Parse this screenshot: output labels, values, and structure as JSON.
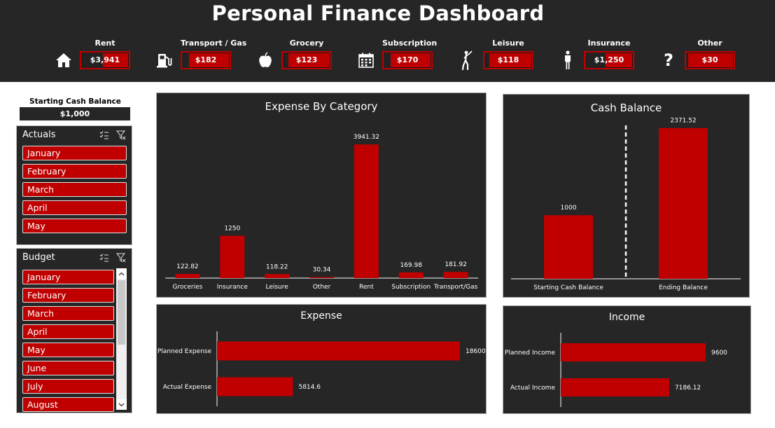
{
  "dashboard": {
    "title": "Personal Finance Dashboard"
  },
  "kpis": [
    {
      "label": "Rent",
      "value": "$3,941",
      "icon": "house-icon",
      "fill": 0.45
    },
    {
      "label": "Transport / Gas",
      "value": "$182",
      "icon": "gas-pump-icon",
      "fill": 0.15
    },
    {
      "label": "Grocery",
      "value": "$123",
      "icon": "apple-icon",
      "fill": 0.12
    },
    {
      "label": "Subscription",
      "value": "$170",
      "icon": "calendar-icon",
      "fill": 0.14
    },
    {
      "label": "Leisure",
      "value": "$118",
      "icon": "golfer-icon",
      "fill": 0.11
    },
    {
      "label": "Insurance",
      "value": "$1,250",
      "icon": "person-icon",
      "fill": 0.42
    },
    {
      "label": "Other",
      "value": "$30",
      "icon": "question-icon",
      "fill": 0.05
    }
  ],
  "cash": {
    "label": "Starting Cash Balance",
    "value": "$1,000"
  },
  "slicers": {
    "actuals": {
      "title": "Actuals",
      "items": [
        "January",
        "February",
        "March",
        "April",
        "May"
      ]
    },
    "budget": {
      "title": "Budget",
      "items": [
        "January",
        "February",
        "March",
        "April",
        "May",
        "June",
        "July",
        "August"
      ]
    }
  },
  "chart_data": [
    {
      "type": "bar",
      "title": "Expense By Category",
      "categories": [
        "Groceries",
        "Insurance",
        "Leisure",
        "Other",
        "Rent",
        "Subscription",
        "Transport/Gas"
      ],
      "values": [
        122.82,
        1250,
        118.22,
        30.34,
        3941.32,
        169.98,
        181.92
      ],
      "value_labels": [
        "122.82",
        "1250",
        "118.22",
        "30.34",
        "3941.32",
        "169.98",
        "181.92"
      ],
      "ylim": [
        0,
        4400
      ],
      "grid": false,
      "legend": false,
      "color": "#c00000"
    },
    {
      "type": "bar",
      "title": "Cash Balance",
      "categories": [
        "Starting Cash Balance",
        "Ending Balance"
      ],
      "values": [
        1000,
        2371.52
      ],
      "value_labels": [
        "1000",
        "2371.52"
      ],
      "ylim": [
        0,
        2600
      ],
      "grid": false,
      "legend": false,
      "color": "#c00000"
    },
    {
      "type": "bar",
      "orientation": "horizontal",
      "title": "Expense",
      "categories": [
        "Planned Expense",
        "Actual Expense"
      ],
      "values": [
        18600,
        5814.6
      ],
      "value_labels": [
        "18600",
        "5814.6"
      ],
      "xlim": [
        0,
        18600
      ],
      "grid": false,
      "legend": false,
      "color": "#c00000"
    },
    {
      "type": "bar",
      "orientation": "horizontal",
      "title": "Income",
      "categories": [
        "Planned Income",
        "Actual Income"
      ],
      "values": [
        9600,
        7186.12
      ],
      "value_labels": [
        "9600",
        "7186.12"
      ],
      "xlim": [
        0,
        9600
      ],
      "grid": false,
      "legend": false,
      "color": "#c00000"
    }
  ]
}
